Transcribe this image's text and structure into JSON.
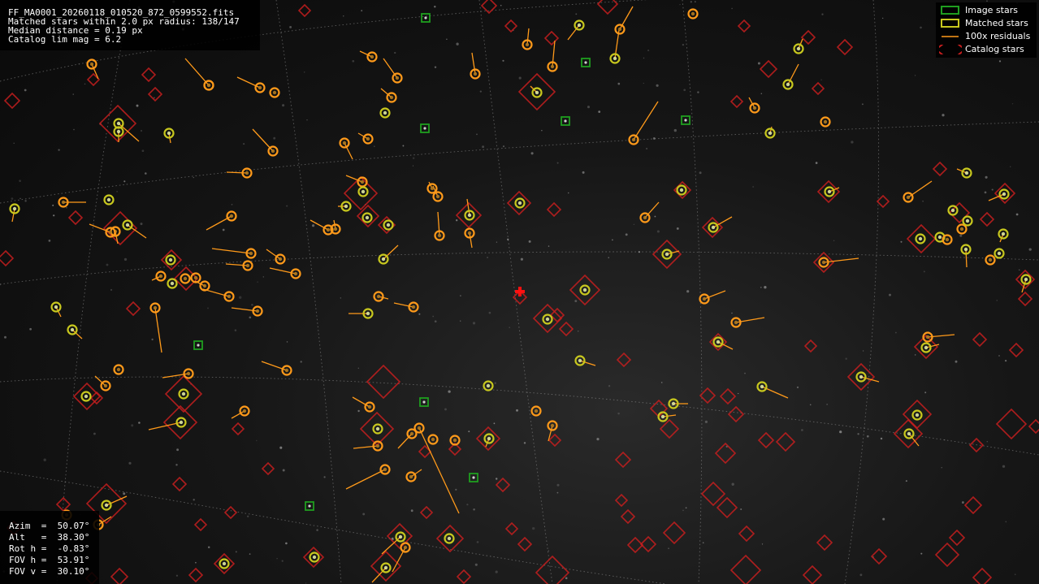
{
  "header": {
    "filename": "FF_MA0001_20260118_010520_872_0599552.fits",
    "matched_line": "Matched stars within 2.0 px radius: 138/147",
    "median_line": "Median distance = 0.19 px",
    "catalog_line": "Catalog lim mag = 6.2"
  },
  "legend": {
    "image_stars": "Image stars",
    "matched_stars": "Matched stars",
    "residuals": "100x residuals",
    "catalog_stars": "Catalog stars"
  },
  "pointing": {
    "azim": "Azim  =  50.07°",
    "alt": "Alt   =  38.30°",
    "rot": "Rot h =  -0.83°",
    "fov_h": "FOV h =  53.91°",
    "fov_v": "FOV v =  30.10°"
  },
  "colors": {
    "image_star": "#1f9e1f",
    "matched_star": "#c8c81e",
    "residual": "#ff9a1a",
    "catalog_star": "#c81e1e",
    "center_marker": "#ff1010",
    "grid": "#9a9a9a"
  },
  "icons": {
    "center": "red-cross-icon"
  }
}
